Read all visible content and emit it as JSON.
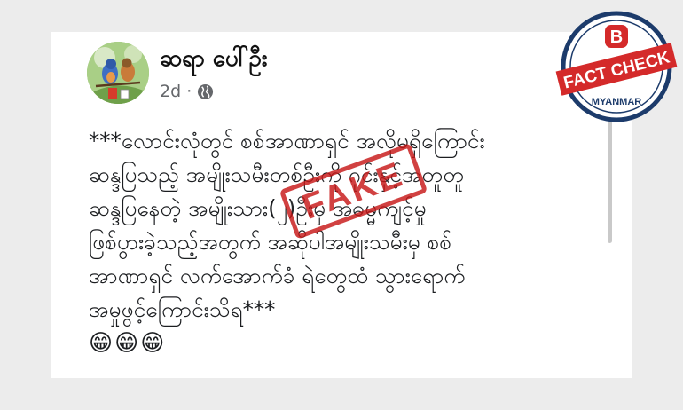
{
  "post": {
    "author": "ဆရာ ပေါ်ဦး",
    "time": "2d ·",
    "lines": [
      "***လောင်းလုံတွင် စစ်အာဏာရှင် အလိုမရှိကြောင်း",
      "ဆန္ဒပြသည့် အမျိုးသမီးတစ်ဦးကို ဂုင်းနှင့်အတူတူ",
      "ဆန္ဒပြနေတဲ့ အမျိုးသား(၂)ဦးမှ အဓမ္မကျင့်မှု",
      "ဖြစ်ပွားခဲ့သည့်အတွက် အဆိုပါအမျိုးသမီးမှ စစ်",
      "အာဏာရှင် လက်အောက်ခံ ရဲတွေထံ သွားရောက်",
      "အမှုဖွင့်ကြောင်းသိရ***"
    ],
    "emojis": "😁😁😁"
  },
  "stamp": {
    "text": "FAKE",
    "color": "#c71818"
  },
  "badge": {
    "letter": "B",
    "ribbon": "FACT CHECK",
    "bottom": "MYANMAR",
    "color": "#d42a2a",
    "navy": "#1c3b6b"
  },
  "icons": {
    "privacy": "globe-icon",
    "menu": "more-dot-icon"
  }
}
